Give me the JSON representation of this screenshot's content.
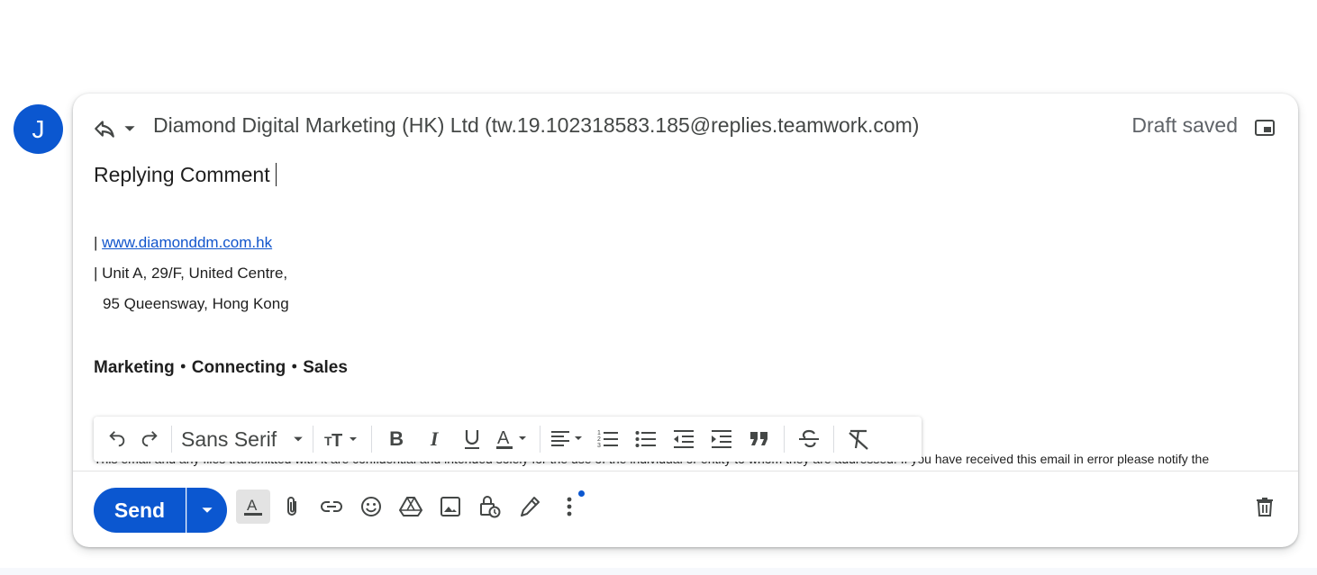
{
  "avatar": {
    "initial": "J",
    "color": "#0b57d0"
  },
  "header": {
    "recipient": "Diamond Digital Marketing (HK) Ltd (tw.19.102318583.185@replies.teamwork.com)",
    "status": "Draft saved"
  },
  "subject": "Replying Comment",
  "signature": {
    "prefix1": "| ",
    "website": "www.diamonddm.com.hk",
    "address_line1": "| Unit A, 29/F, United Centre,",
    "address_line2": "95 Queensway, Hong Kong",
    "tagline": "Marketing・Connecting・Sales",
    "disclaimer": "This email and any files transmitted with it are confidential and intended solely for the use of the individual or entity to whom they are addressed. If you have received this email in error please notify the"
  },
  "format_toolbar": {
    "font": "Sans Serif",
    "icons": [
      "undo-icon",
      "redo-icon",
      "font-size-icon",
      "bold-icon",
      "italic-icon",
      "underline-icon",
      "text-color-icon",
      "align-icon",
      "numbered-list-icon",
      "bulleted-list-icon",
      "indent-less-icon",
      "indent-more-icon",
      "quote-icon",
      "strikethrough-icon",
      "remove-formatting-icon"
    ]
  },
  "bottom_bar": {
    "send_label": "Send",
    "icons": [
      "formatting-options-icon",
      "attach-icon",
      "link-icon",
      "emoji-icon",
      "drive-icon",
      "photo-icon",
      "confidential-mode-icon",
      "signature-icon",
      "more-options-icon",
      "discard-draft-icon"
    ]
  },
  "colors": {
    "primary": "#0b57d0",
    "link": "#1155cc"
  }
}
